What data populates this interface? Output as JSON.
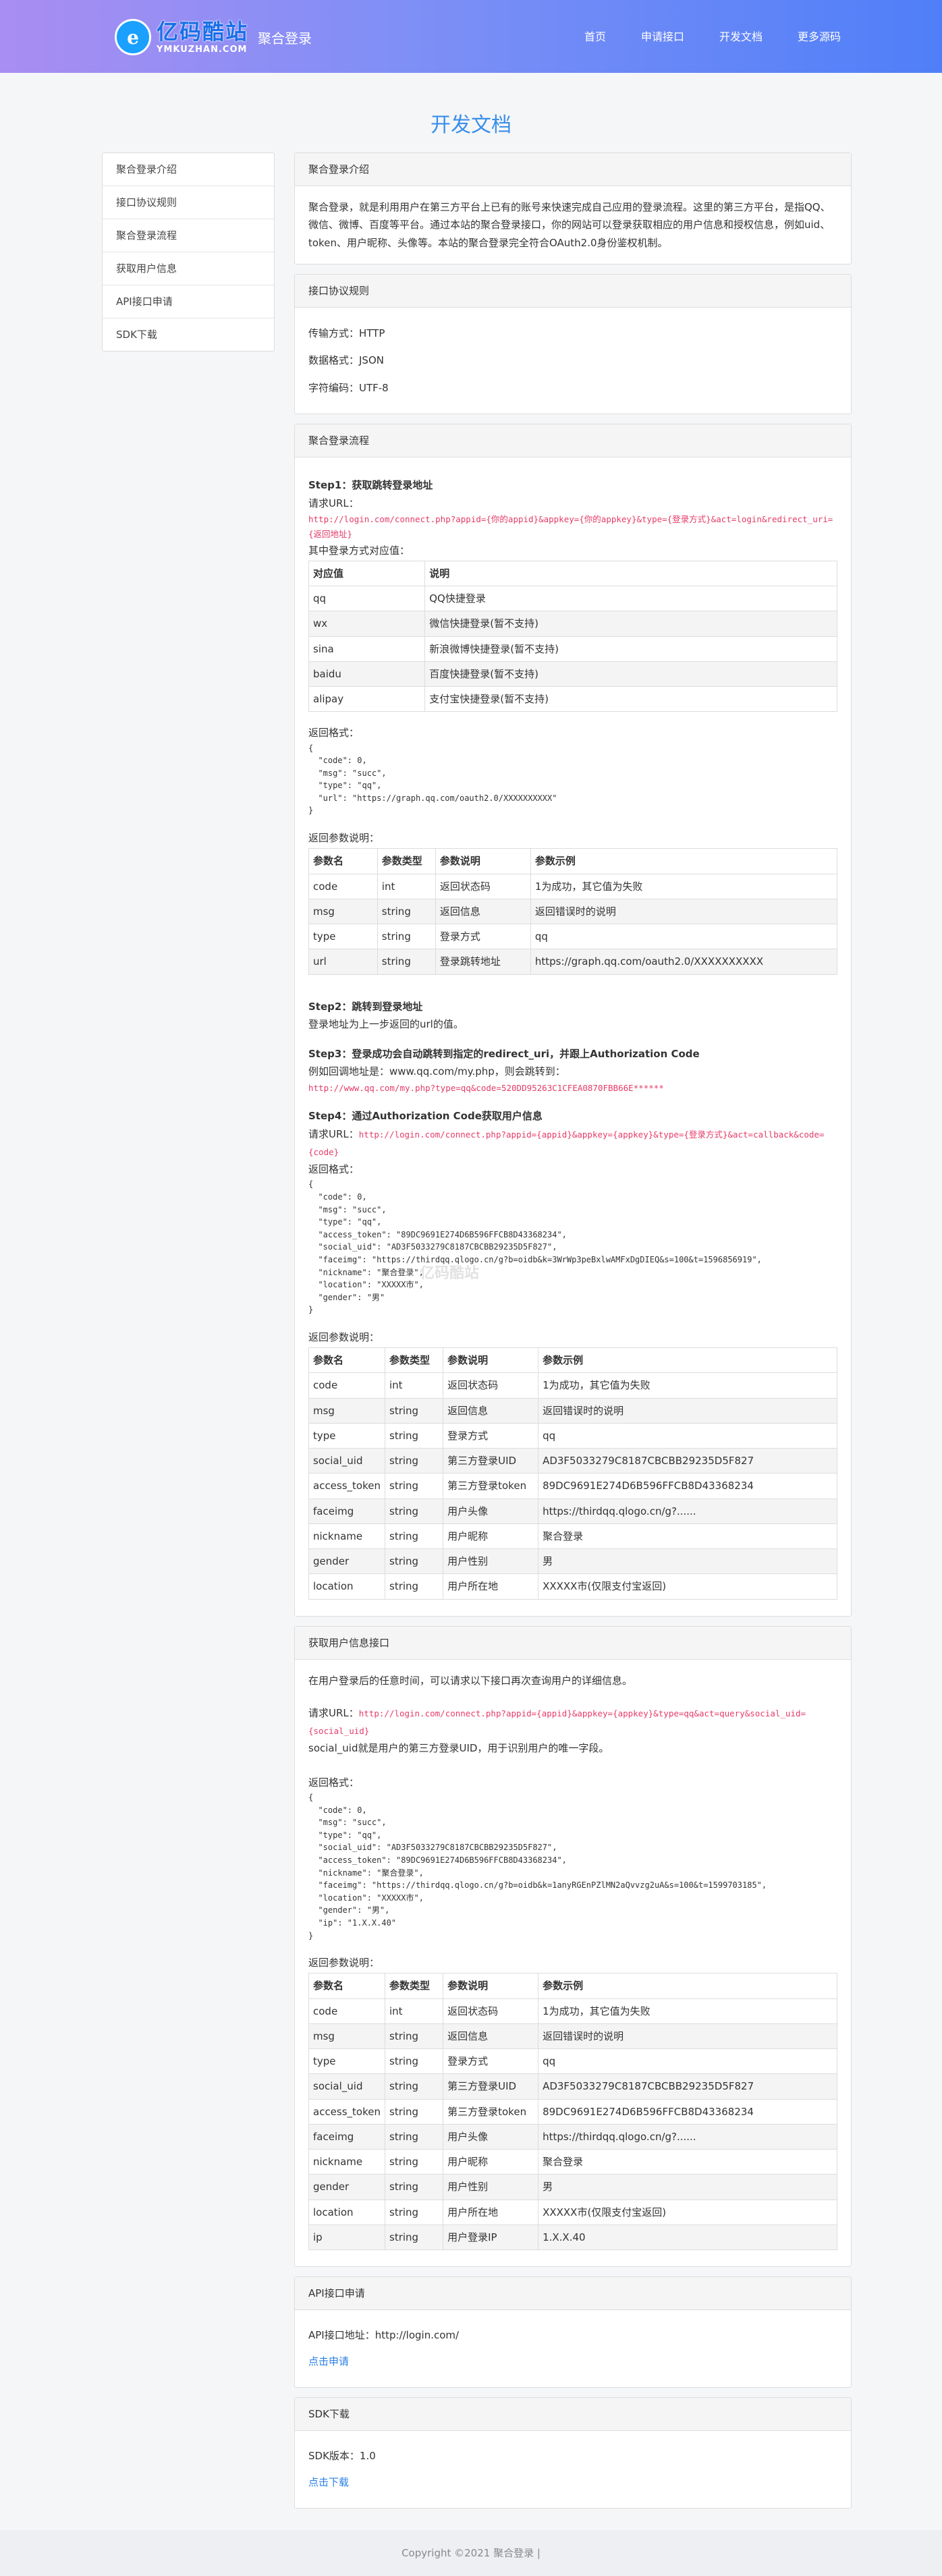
{
  "header": {
    "logo_cn": "亿码酷站",
    "logo_en": "YMKUZHAN.COM",
    "site_name": "聚合登录",
    "nav": [
      "首页",
      "申请接口",
      "开发文档",
      "更多源码"
    ]
  },
  "page_title": "开发文档",
  "sidebar": [
    "聚合登录介绍",
    "接口协议规则",
    "聚合登录流程",
    "获取用户信息",
    "API接口申请",
    "SDK下载"
  ],
  "intro": {
    "title": "聚合登录介绍",
    "text": "聚合登录，就是利用用户在第三方平台上已有的账号来快速完成自己应用的登录流程。这里的第三方平台，是指QQ、微信、微博、百度等平台。通过本站的聚合登录接口，你的网站可以登录获取相应的用户信息和授权信息，例如uid、token、用户昵称、头像等。本站的聚合登录完全符合OAuth2.0身份鉴权机制。"
  },
  "protocol": {
    "title": "接口协议规则",
    "lines": [
      "传输方式：HTTP",
      "数据格式：JSON",
      "字符编码：UTF-8"
    ]
  },
  "flow": {
    "title": "聚合登录流程",
    "step1_title": "Step1：获取跳转登录地址",
    "request_url_label": "请求URL：",
    "step1_url": "http://login.com/connect.php?appid={你的appid}&appkey={你的appkey}&type={登录方式}&act=login&redirect_uri={返回地址}",
    "type_table_caption": "其中登录方式对应值：",
    "type_table_head": [
      "对应值",
      "说明"
    ],
    "type_table_rows": [
      [
        "qq",
        "QQ快捷登录"
      ],
      [
        "wx",
        "微信快捷登录(暂不支持)"
      ],
      [
        "sina",
        "新浪微博快捷登录(暂不支持)"
      ],
      [
        "baidu",
        "百度快捷登录(暂不支持)"
      ],
      [
        "alipay",
        "支付宝快捷登录(暂不支持)"
      ]
    ],
    "return_format_label": "返回格式：",
    "step1_json": "{\n  \"code\": 0,\n  \"msg\": \"succ\",\n  \"type\": \"qq\",\n  \"url\": \"https://graph.qq.com/oauth2.0/XXXXXXXXXX\"\n}",
    "return_params_label": "返回参数说明：",
    "params_head": [
      "参数名",
      "参数类型",
      "参数说明",
      "参数示例"
    ],
    "step1_params": [
      [
        "code",
        "int",
        "返回状态码",
        "1为成功，其它值为失败"
      ],
      [
        "msg",
        "string",
        "返回信息",
        "返回错误时的说明"
      ],
      [
        "type",
        "string",
        "登录方式",
        "qq"
      ],
      [
        "url",
        "string",
        "登录跳转地址",
        "https://graph.qq.com/oauth2.0/XXXXXXXXXX"
      ]
    ],
    "step2_title": "Step2：跳转到登录地址",
    "step2_text": "登录地址为上一步返回的url的值。",
    "step3_title": "Step3：登录成功会自动跳转到指定的redirect_uri，并跟上Authorization Code",
    "step3_text": "例如回调地址是：www.qq.com/my.php，则会跳转到：",
    "step3_url": "http://www.qq.com/my.php?type=qq&code=520DD95263C1CFEA0870FBB66E******",
    "step4_title": "Step4：通过Authorization Code获取用户信息",
    "step4_url": "http://login.com/connect.php?appid={appid}&appkey={appkey}&type={登录方式}&act=callback&code={code}",
    "step4_json": "{\n  \"code\": 0,\n  \"msg\": \"succ\",\n  \"type\": \"qq\",\n  \"access_token\": \"89DC9691E274D6B596FFCB8D43368234\",\n  \"social_uid\": \"AD3F5033279C8187CBCBB29235D5F827\",\n  \"faceimg\": \"https://thirdqq.qlogo.cn/g?b=oidb&k=3WrWp3peBxlwAMFxDgDIEQ&s=100&t=1596856919\",\n  \"nickname\": \"聚合登录\",\n  \"location\": \"XXXXX市\",\n  \"gender\": \"男\"\n}",
    "step4_params": [
      [
        "code",
        "int",
        "返回状态码",
        "1为成功，其它值为失败"
      ],
      [
        "msg",
        "string",
        "返回信息",
        "返回错误时的说明"
      ],
      [
        "type",
        "string",
        "登录方式",
        "qq"
      ],
      [
        "social_uid",
        "string",
        "第三方登录UID",
        "AD3F5033279C8187CBCBB29235D5F827"
      ],
      [
        "access_token",
        "string",
        "第三方登录token",
        "89DC9691E274D6B596FFCB8D43368234"
      ],
      [
        "faceimg",
        "string",
        "用户头像",
        "https://thirdqq.qlogo.cn/g?......"
      ],
      [
        "nickname",
        "string",
        "用户昵称",
        "聚合登录"
      ],
      [
        "gender",
        "string",
        "用户性别",
        "男"
      ],
      [
        "location",
        "string",
        "用户所在地",
        "XXXXX市(仅限支付宝返回)"
      ]
    ]
  },
  "userinfo": {
    "title": "获取用户信息接口",
    "text": "在用户登录后的任意时间，可以请求以下接口再次查询用户的详细信息。",
    "url": "http://login.com/connect.php?appid={appid}&appkey={appkey}&type=qq&act=query&social_uid={social_uid}",
    "uid_note": "social_uid就是用户的第三方登录UID，用于识别用户的唯一字段。",
    "json": "{\n  \"code\": 0,\n  \"msg\": \"succ\",\n  \"type\": \"qq\",\n  \"social_uid\": \"AD3F5033279C8187CBCBB29235D5F827\",\n  \"access_token\": \"89DC9691E274D6B596FFCB8D43368234\",\n  \"nickname\": \"聚合登录\",\n  \"faceimg\": \"https://thirdqq.qlogo.cn/g?b=oidb&k=1anyRGEnPZlMN2aQvvzg2uA&s=100&t=1599703185\",\n  \"location\": \"XXXXX市\",\n  \"gender\": \"男\",\n  \"ip\": \"1.X.X.40\"\n}",
    "params": [
      [
        "code",
        "int",
        "返回状态码",
        "1为成功，其它值为失败"
      ],
      [
        "msg",
        "string",
        "返回信息",
        "返回错误时的说明"
      ],
      [
        "type",
        "string",
        "登录方式",
        "qq"
      ],
      [
        "social_uid",
        "string",
        "第三方登录UID",
        "AD3F5033279C8187CBCBB29235D5F827"
      ],
      [
        "access_token",
        "string",
        "第三方登录token",
        "89DC9691E274D6B596FFCB8D43368234"
      ],
      [
        "faceimg",
        "string",
        "用户头像",
        "https://thirdqq.qlogo.cn/g?......"
      ],
      [
        "nickname",
        "string",
        "用户昵称",
        "聚合登录"
      ],
      [
        "gender",
        "string",
        "用户性别",
        "男"
      ],
      [
        "location",
        "string",
        "用户所在地",
        "XXXXX市(仅限支付宝返回)"
      ],
      [
        "ip",
        "string",
        "用户登录IP",
        "1.X.X.40"
      ]
    ]
  },
  "api": {
    "title": "API接口申请",
    "text": "API接口地址：http://login.com/",
    "link": "点击申请"
  },
  "sdk": {
    "title": "SDK下载",
    "text": "SDK版本：1.0",
    "link": "点击下载"
  },
  "watermark": "亿码酷站",
  "footer": "Copyright ©2021 聚合登录 |"
}
